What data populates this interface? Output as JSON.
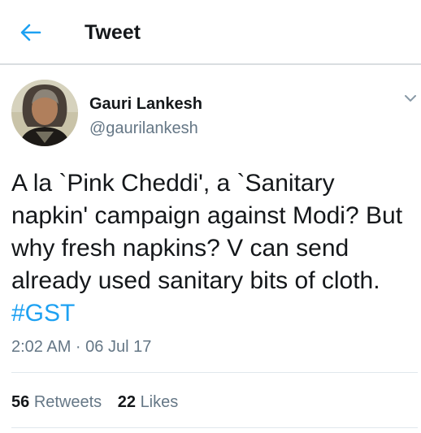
{
  "header": {
    "back_icon": "arrow-left-icon",
    "title": "Tweet"
  },
  "author": {
    "display_name": "Gauri Lankesh",
    "handle": "@gaurilankesh",
    "avatar_icon": "profile-photo",
    "menu_icon": "chevron-down-icon"
  },
  "tweet": {
    "text": "A la `Pink Cheddi', a `Sanitary napkin' campaign against Modi? But why fresh napkins? V can send already used sanitary bits of cloth.",
    "hashtag": "#GST",
    "timestamp": "2:02 AM · 06 Jul 17"
  },
  "stats": {
    "retweets_count": "56",
    "retweets_label": "Retweets",
    "likes_count": "22",
    "likes_label": "Likes"
  },
  "colors": {
    "accent": "#1da1f2",
    "secondary_text": "#657786",
    "primary_text": "#14171a",
    "divider": "#e1e8ed"
  }
}
